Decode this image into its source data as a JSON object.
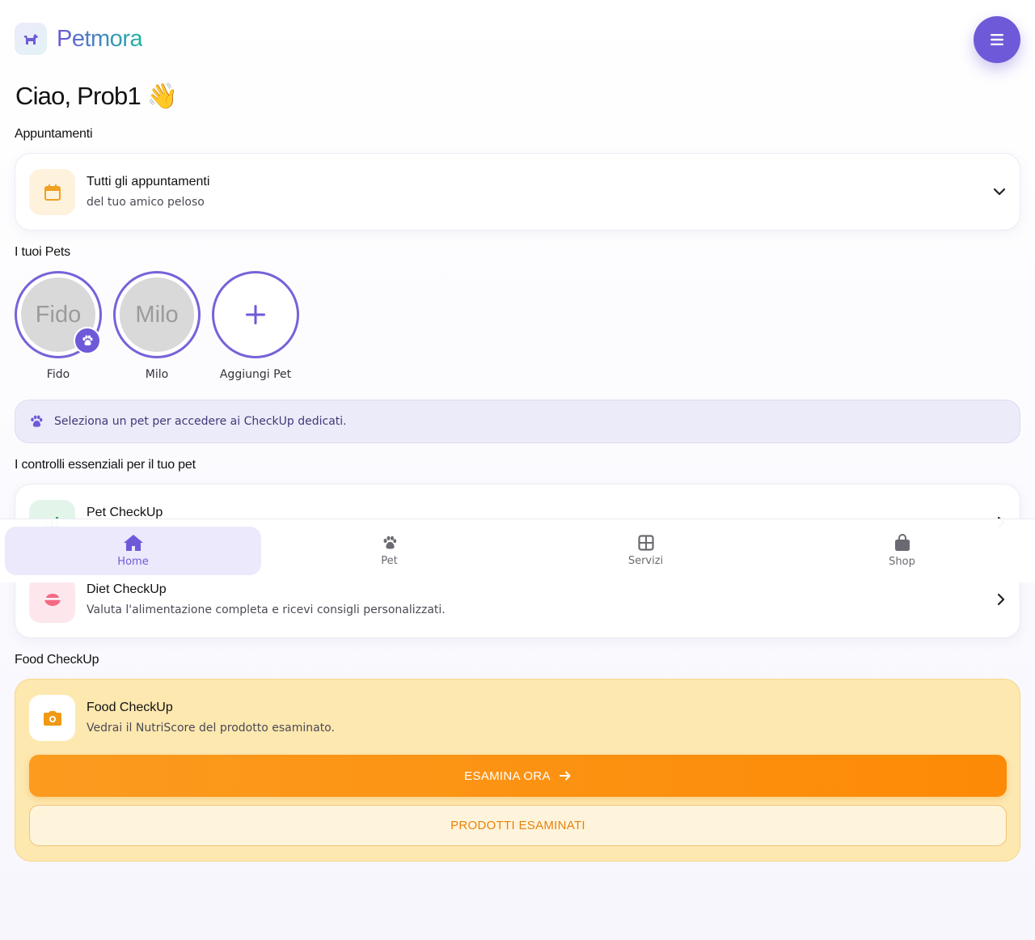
{
  "app": {
    "brand": "Petmora",
    "logo_icon": "dog-icon",
    "menu_icon": "menu-icon"
  },
  "greeting": "Ciao, Prob1 👋",
  "appointments": {
    "section_title": "Appuntamenti",
    "title": "Tutti gli appuntamenti",
    "subtitle": "del tuo amico peloso",
    "icon": "calendar-icon",
    "expand_icon": "chevron-down-icon"
  },
  "pets": {
    "section_title": "I tuoi Pets",
    "items": [
      {
        "name": "Fido",
        "avatar_text": "Fido",
        "selected_badge": "paw-icon"
      },
      {
        "name": "Milo",
        "avatar_text": "Milo"
      }
    ],
    "add_label": "Aggiungi Pet",
    "add_icon": "plus-icon"
  },
  "info_banner": {
    "text": "Seleziona un pet per accedere ai CheckUp dedicati.",
    "icon": "paw-icon"
  },
  "checkups": {
    "section_title": "I controlli essenziali per il tuo pet",
    "items": [
      {
        "title": "Pet CheckUp",
        "subtitle": "",
        "icon": "chart-icon"
      },
      {
        "title": "Diet CheckUp",
        "subtitle": "Valuta l'alimentazione completa e ricevi consigli personalizzati.",
        "icon": "food-bowl-icon"
      }
    ]
  },
  "food_checkup": {
    "section_title": "Food CheckUp",
    "title": "Food CheckUp",
    "subtitle": "Vedrai il NutriScore del prodotto esaminato.",
    "primary_button": "ESAMINA ORA",
    "secondary_button": "PRODOTTI ESAMINATI",
    "icon": "camera-icon"
  },
  "bottom_nav": {
    "items": [
      {
        "label": "Home",
        "icon": "home-icon",
        "active": true
      },
      {
        "label": "Pet",
        "icon": "paw-icon"
      },
      {
        "label": "Servizi",
        "icon": "grid-icon"
      },
      {
        "label": "Shop",
        "icon": "shopping-bag-icon"
      }
    ]
  },
  "colors": {
    "accent": "#6e5ad8",
    "orange": "#fd8a06",
    "food_card_bg": "#fde8b0",
    "info_bg": "#ecebf9"
  }
}
